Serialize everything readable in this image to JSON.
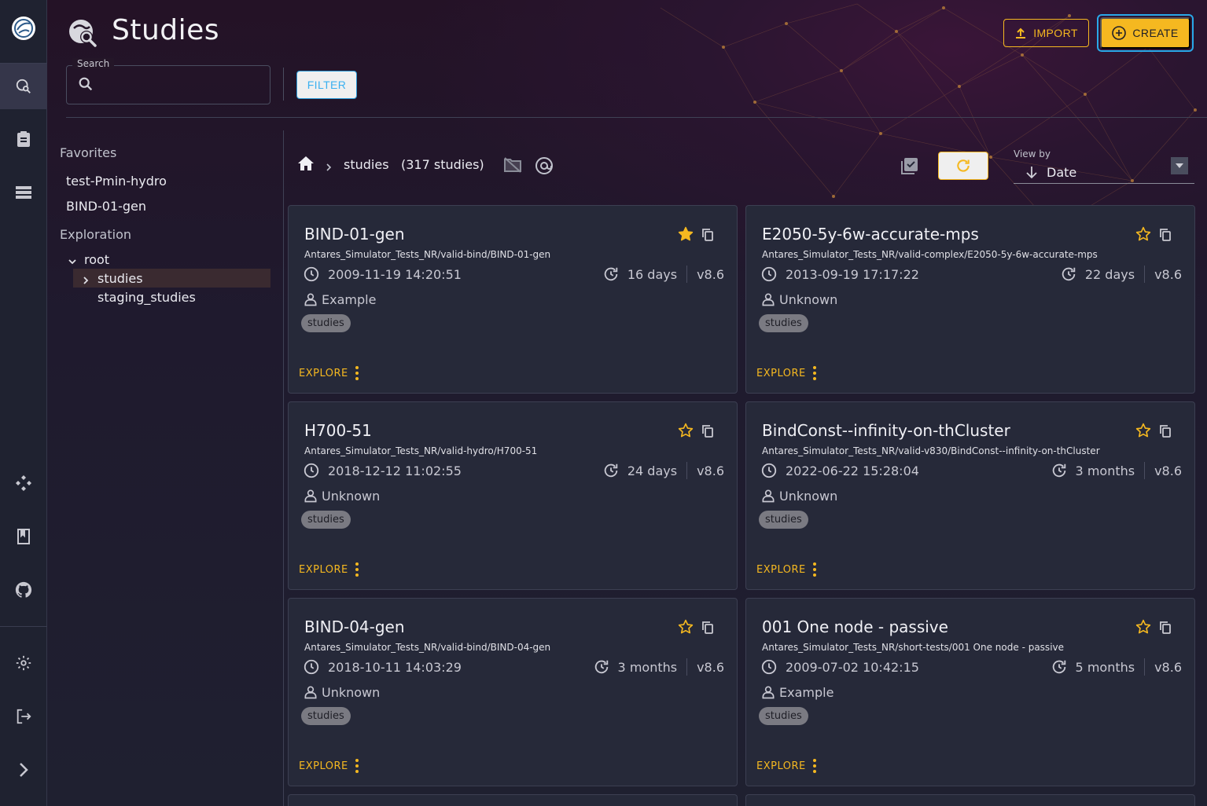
{
  "header": {
    "title": "Studies",
    "import_label": "IMPORT",
    "create_label": "CREATE"
  },
  "search": {
    "label": "Search",
    "placeholder": ""
  },
  "filter_label": "FILTER",
  "sidebar": {
    "favorites_heading": "Favorites",
    "favorites": [
      "test-Pmin-hydro",
      "BIND-01-gen"
    ],
    "exploration_heading": "Exploration",
    "tree": {
      "root": "root",
      "children": [
        "studies",
        "staging_studies"
      ],
      "selected": "studies"
    }
  },
  "breadcrumb": {
    "folder": "studies",
    "count": "(317 studies)"
  },
  "view_by": {
    "label": "View by",
    "value": "Date"
  },
  "colors": {
    "accent": "#f5b820",
    "focus": "#29a8e8",
    "filter": "#3ab0f0"
  },
  "cards": [
    {
      "title": "BIND-01-gen",
      "path": "Antares_Simulator_Tests_NR/valid-bind/BIND-01-gen",
      "date": "2009-11-19 14:20:51",
      "age": "16 days",
      "version": "v8.6",
      "owner": "Example",
      "tag": "studies",
      "favorite": true,
      "explore": "EXPLORE"
    },
    {
      "title": "E2050-5y-6w-accurate-mps",
      "path": "Antares_Simulator_Tests_NR/valid-complex/E2050-5y-6w-accurate-mps",
      "date": "2013-09-19 17:17:22",
      "age": "22 days",
      "version": "v8.6",
      "owner": "Unknown",
      "tag": "studies",
      "favorite": false,
      "explore": "EXPLORE"
    },
    {
      "title": "H700-51",
      "path": "Antares_Simulator_Tests_NR/valid-hydro/H700-51",
      "date": "2018-12-12 11:02:55",
      "age": "24 days",
      "version": "v8.6",
      "owner": "Unknown",
      "tag": "studies",
      "favorite": false,
      "explore": "EXPLORE"
    },
    {
      "title": "BindConst--infinity-on-thCluster",
      "path": "Antares_Simulator_Tests_NR/valid-v830/BindConst--infinity-on-thCluster",
      "date": "2022-06-22 15:28:04",
      "age": "3 months",
      "version": "v8.6",
      "owner": "Unknown",
      "tag": "studies",
      "favorite": false,
      "explore": "EXPLORE"
    },
    {
      "title": "BIND-04-gen",
      "path": "Antares_Simulator_Tests_NR/valid-bind/BIND-04-gen",
      "date": "2018-10-11 14:03:29",
      "age": "3 months",
      "version": "v8.6",
      "owner": "Unknown",
      "tag": "studies",
      "favorite": false,
      "explore": "EXPLORE"
    },
    {
      "title": "001 One node - passive",
      "path": "Antares_Simulator_Tests_NR/short-tests/001 One node - passive",
      "date": "2009-07-02 10:42:15",
      "age": "5 months",
      "version": "v8.6",
      "owner": "Example",
      "tag": "studies",
      "favorite": false,
      "explore": "EXPLORE"
    }
  ]
}
